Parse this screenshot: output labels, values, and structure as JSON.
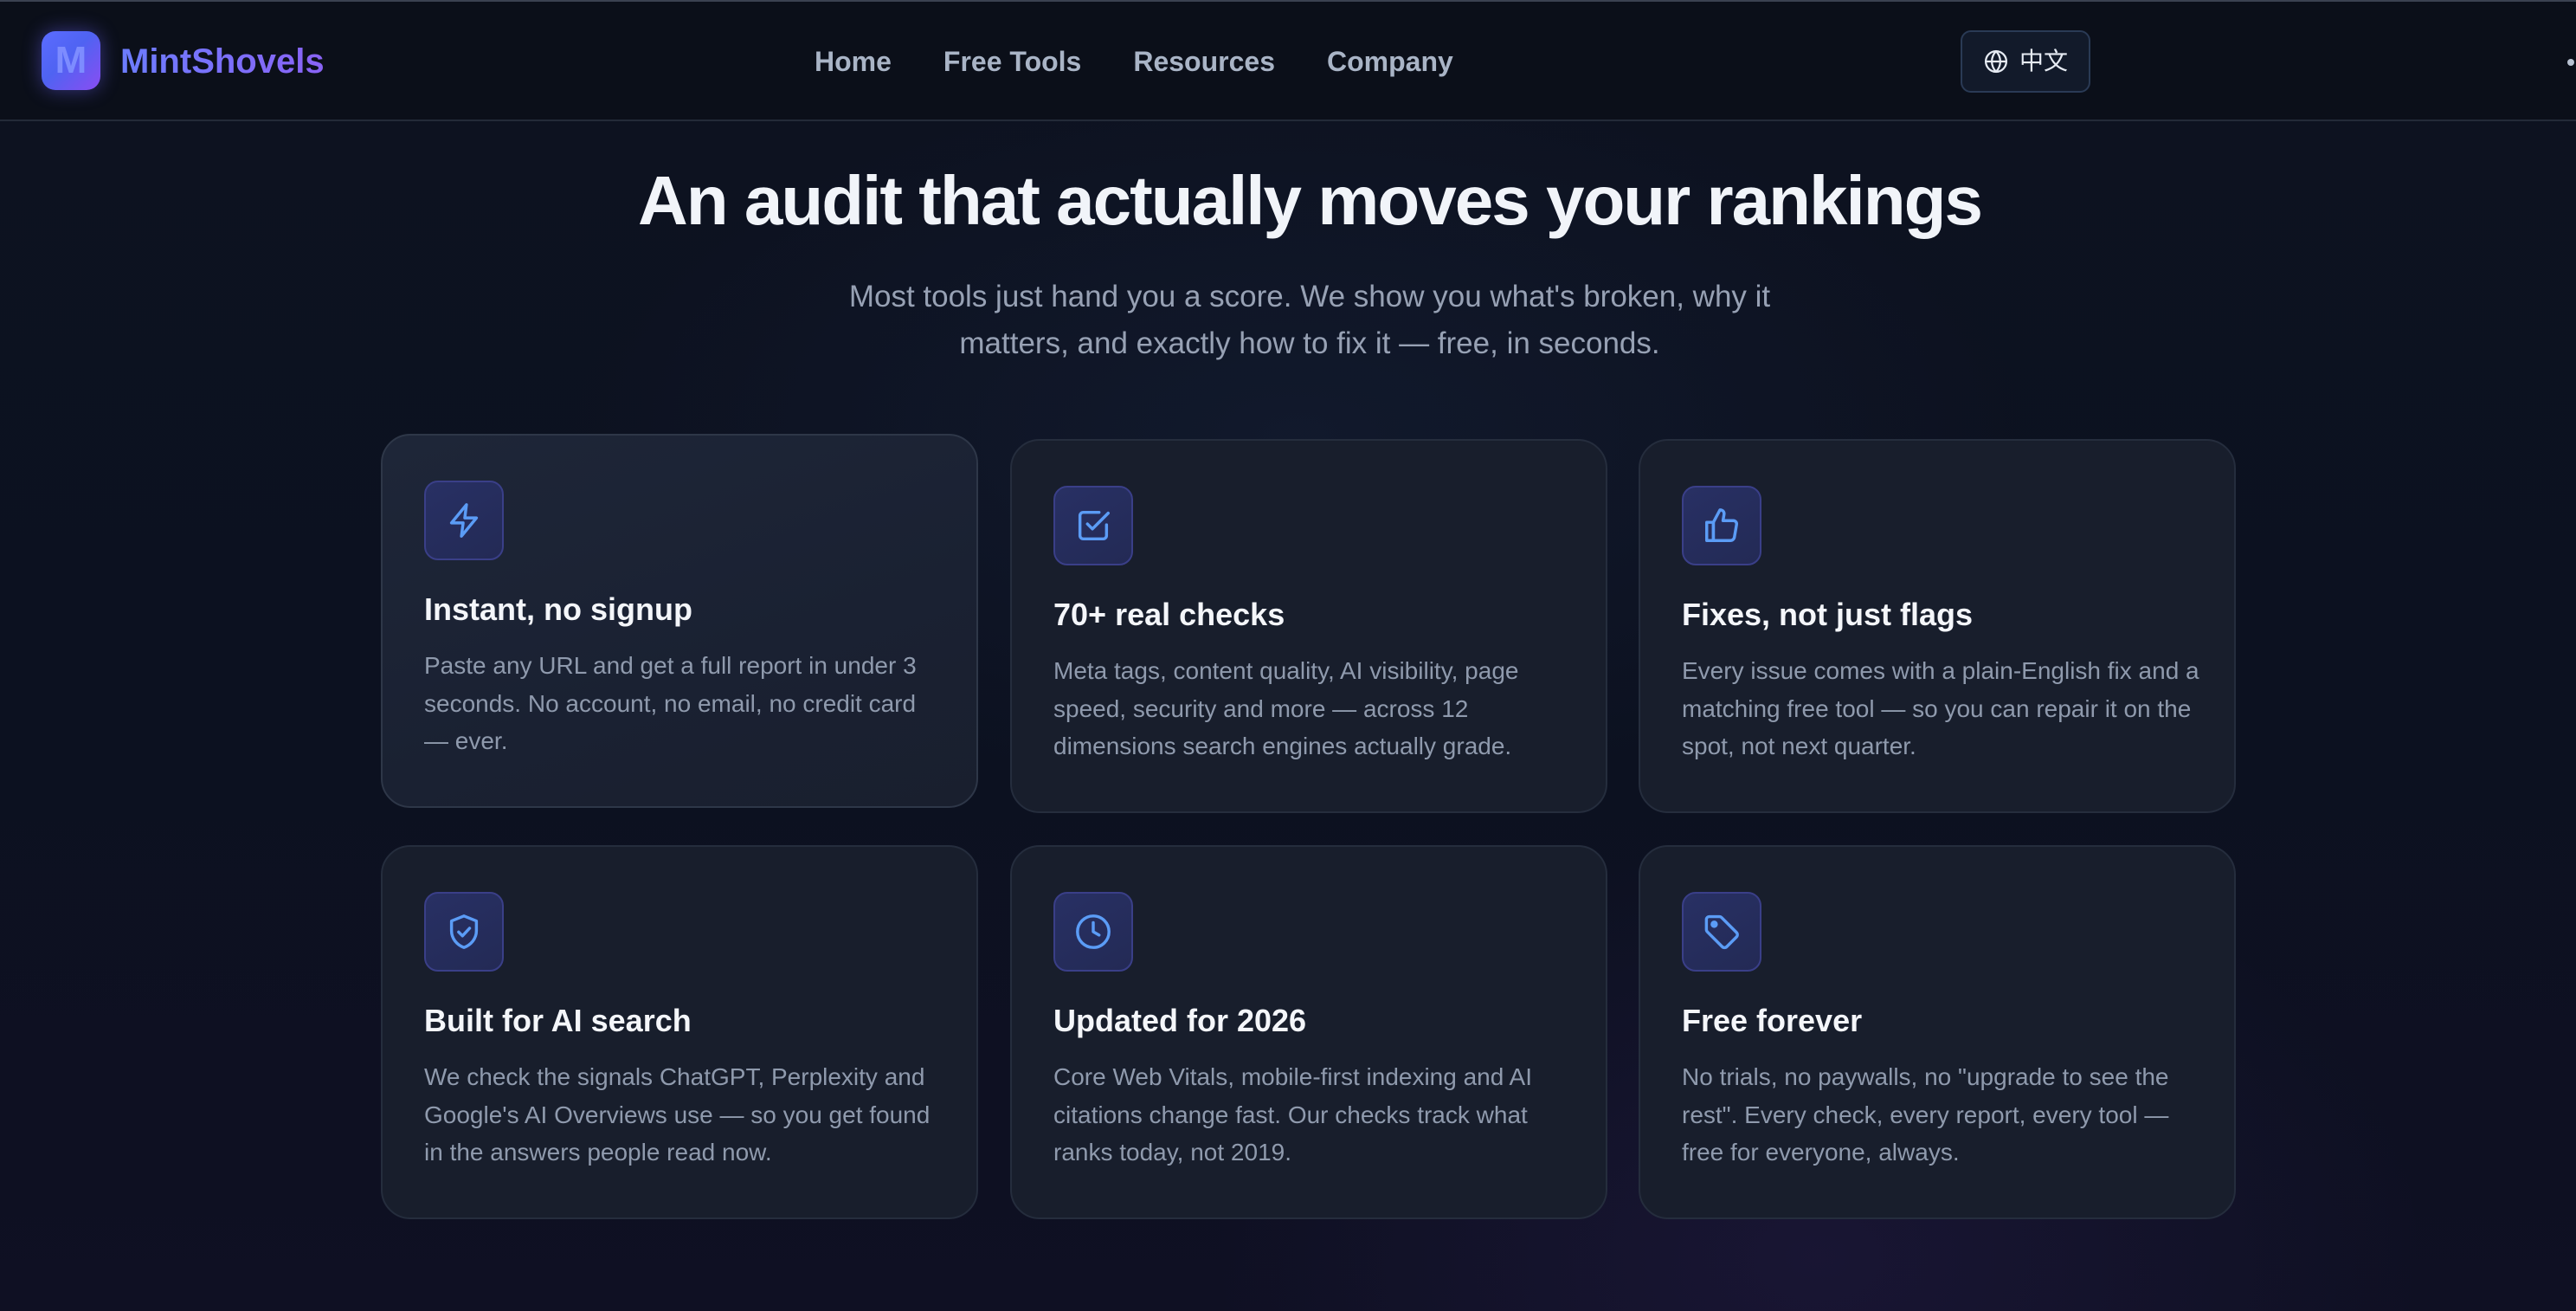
{
  "header": {
    "logo_letter": "M",
    "brand_name": "MintShovels",
    "nav": [
      "Home",
      "Free Tools",
      "Resources",
      "Company"
    ],
    "language_label": "中文"
  },
  "hero": {
    "title": "An audit that actually moves your rankings",
    "subtitle": "Most tools just hand you a score. We show you what's broken, why it matters, and exactly how to fix it — free, in seconds."
  },
  "features": [
    {
      "icon": "lightning-icon",
      "title": "Instant, no signup",
      "description": "Paste any URL and get a full report in under 3 seconds. No account, no email, no credit card — ever."
    },
    {
      "icon": "checkbox-icon",
      "title": "70+ real checks",
      "description": "Meta tags, content quality, AI visibility, page speed, security and more — across 12 dimensions search engines actually grade."
    },
    {
      "icon": "thumbs-up-icon",
      "title": "Fixes, not just flags",
      "description": "Every issue comes with a plain-English fix and a matching free tool — so you can repair it on the spot, not next quarter."
    },
    {
      "icon": "shield-check-icon",
      "title": "Built for AI search",
      "description": "We check the signals ChatGPT, Perplexity and Google's AI Overviews use — so you get found in the answers people read now."
    },
    {
      "icon": "clock-icon",
      "title": "Updated for 2026",
      "description": "Core Web Vitals, mobile-first indexing and AI citations change fast. Our checks track what ranks today, not 2019."
    },
    {
      "icon": "tag-icon",
      "title": "Free forever",
      "description": "No trials, no paywalls, no \"upgrade to see the rest\". Every check, every report, every tool — free for everyone, always."
    }
  ],
  "colors": {
    "background": "#0c111c",
    "accent": "#6c7dff",
    "accent_purple": "#8a63f5",
    "icon_stroke": "#5b9cf6",
    "card_background": "#181e2c"
  }
}
